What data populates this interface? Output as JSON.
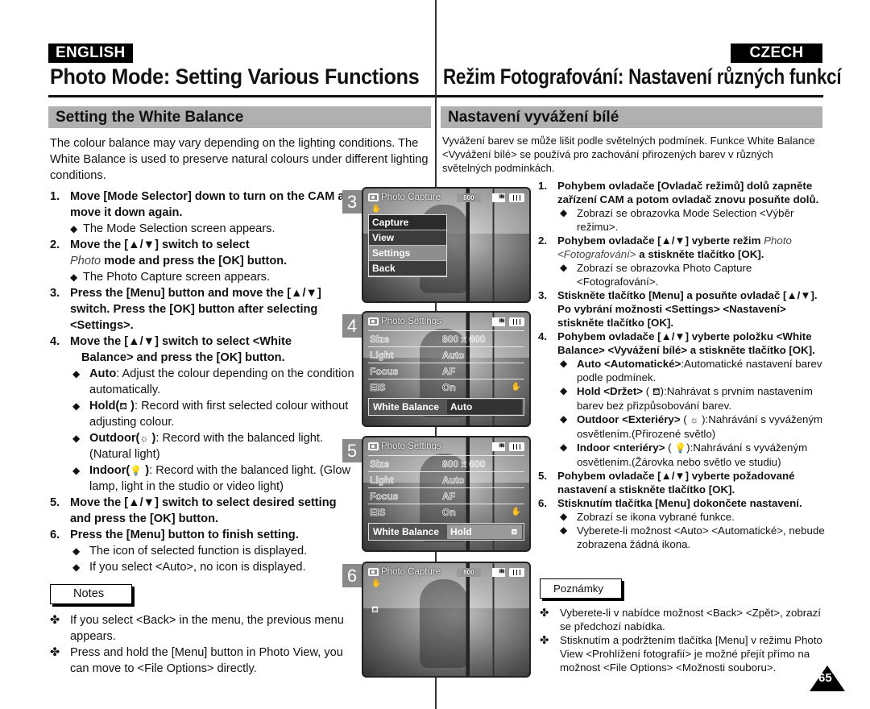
{
  "header": {
    "lang_en": "ENGLISH",
    "lang_cz": "CZECH",
    "title_en": "Photo Mode: Setting Various Functions",
    "title_cz": "Režim Fotografování: Nastavení různých funkcí"
  },
  "english": {
    "section_title": "Setting the White Balance",
    "intro": "The colour balance may vary depending on the lighting conditions. The White Balance is used to preserve natural colours under different lighting conditions.",
    "steps": [
      {
        "num": "1.",
        "text": "Move [Mode Selector] down to turn on the CAM and move it down again.",
        "sub": "The Mode Selection screen appears."
      },
      {
        "num": "2.",
        "text_italic": "Photo",
        "text_pre": "Move the [▲/▼] switch to select",
        "text_post": "mode and press the [OK] button.",
        "sub": "The Photo Capture screen appears."
      },
      {
        "num": "3.",
        "text": "Press the [Menu] button and move the [▲/▼] switch. Press the [OK] button after selecting <Settings>."
      },
      {
        "num": "4.",
        "text_a": "Move the [▲/▼] switch to select <White",
        "text_b": "Balance> and press the [OK] button."
      },
      {
        "num": "5.",
        "text": "Move the [▲/▼] switch to select desired setting and press the [OK] button."
      },
      {
        "num": "6.",
        "text": "Press the [Menu] button to finish setting."
      }
    ],
    "wb_options": [
      {
        "label": "Auto",
        "icon": "",
        "desc": ": Adjust the colour depending on the condition automatically."
      },
      {
        "label": "Hold(",
        "icon": "hold-icon",
        "icon_glyph": "⛾",
        "label_end": " )",
        "desc": ": Record with first selected colour without adjusting colour."
      },
      {
        "label": "Outdoor(",
        "icon": "outdoor-sun-icon",
        "icon_glyph": "☼",
        "label_end": " )",
        "desc": ": Record with the balanced light. (Natural light)"
      },
      {
        "label": "Indoor(",
        "icon": "indoor-bulb-icon",
        "icon_glyph": "💡",
        "label_end": " )",
        "desc": ": Record with the balanced light. (Glow lamp, light in the studio or video light)"
      }
    ],
    "step6_subs": [
      "The icon of selected function is displayed.",
      "If you select <Auto>, no icon is displayed."
    ],
    "notes_label": "Notes",
    "notes": [
      "If you select <Back> in the menu, the previous menu appears.",
      "Press and hold the [Menu] button in Photo View, you can move to <File Options> directly."
    ]
  },
  "czech": {
    "section_title": "Nastavení vyvážení bílé",
    "intro": "Vyvážení barev se může lišit podle světelných podmínek. Funkce White Balance <Vyvážení bílé> se používá pro zachování přirozených barev v různých světelných podmínkách.",
    "steps": [
      {
        "num": "1.",
        "text": "Pohybem ovladače [Ovladač režimů] dolů zapněte zařízení CAM a potom ovladač znovu posuňte dolů.",
        "sub": "Zobrazí se obrazovka Mode Selection <Výběr režimu>."
      },
      {
        "num": "2.",
        "text_pre": "Pohybem ovladače [▲/▼] vyberte režim",
        "text_italic": "Photo <Fotografování>",
        "text_post": "a stiskněte tlačítko [OK].",
        "sub": "Zobrazí se obrazovka Photo Capture <Fotografování>."
      },
      {
        "num": "3.",
        "text": "Stiskněte tlačítko [Menu] a posuňte ovladač [▲/▼]. Po vybrání možnosti <Settings> <Nastavení> stiskněte tlačítko [OK]."
      },
      {
        "num": "4.",
        "text": "Pohybem ovladače [▲/▼] vyberte položku <White Balance> <Vyvážení bílé> a stiskněte tlačítko [OK]."
      },
      {
        "num": "5.",
        "text": "Pohybem ovladače [▲/▼] vyberte požadované nastavení a stiskněte tlačítko [OK]."
      },
      {
        "num": "6.",
        "text": "Stisknutím tlačítka [Menu] dokončete nastavení."
      }
    ],
    "wb_options": [
      {
        "label": "Auto <Automatické>",
        "desc": ":Automatické nastavení barev podle podmínek."
      },
      {
        "label": "Hold <Držet>",
        "pre_icon": " ( ",
        "icon_glyph": "⛾",
        "desc": "):Nahrávat s prvním nastavením barev bez přizpůsobování barev."
      },
      {
        "label": "Outdoor <Exteriéry>",
        "pre_icon": " ( ",
        "icon_glyph": "☼",
        "desc": " ):Nahrávání s vyváženým osvětlením.(Přirozené světlo)"
      },
      {
        "label": "Indoor <nteriéry>",
        "pre_icon": " ( ",
        "icon_glyph": "💡",
        "desc": "):Nahrávání s vyváženým osvětlením.(Žárovka nebo světlo ve studiu)"
      }
    ],
    "step6_subs": [
      "Zobrazí se ikona vybrané funkce.",
      "Vyberete-li možnost <Auto> <Automatické>, nebude zobrazena žádná ikona."
    ],
    "notes_label": "Poznámky",
    "notes": [
      "Vyberete-li v nabídce možnost <Back> <Zpět>, zobrazí se předchozí nabídka.",
      "Stisknutím a podržtením tlačítka [Menu] v režimu Photo View <Prohlížení fotografií> je možné přejít přímo na možnost <File Options> <Možnosti souboru>."
    ]
  },
  "screens": [
    {
      "step": "3",
      "title": "Photo Capture",
      "resolution": "800",
      "memory": "IN",
      "menu": [
        "Capture",
        "View",
        "Settings",
        "Back"
      ],
      "highlighted": "Settings"
    },
    {
      "step": "4",
      "title": "Photo Settings",
      "memory": "IN",
      "rows": [
        {
          "label": "Size",
          "value": "800 x 600"
        },
        {
          "label": "Light",
          "value": "Auto"
        },
        {
          "label": "Focus",
          "value": "AF"
        },
        {
          "label": "EIS",
          "value": "On"
        }
      ],
      "wb_label": "White Balance",
      "wb_value": "Auto"
    },
    {
      "step": "5",
      "title": "Photo Settings",
      "memory": "IN",
      "rows": [
        {
          "label": "Size",
          "value": "800 x 600"
        },
        {
          "label": "Light",
          "value": "Auto"
        },
        {
          "label": "Focus",
          "value": "AF"
        },
        {
          "label": "EIS",
          "value": "On"
        }
      ],
      "wb_label": "White Balance",
      "wb_value": "Hold"
    },
    {
      "step": "6",
      "title": "Photo Capture",
      "resolution": "800",
      "memory": "IN"
    }
  ],
  "glyphs": {
    "bullet": "◆",
    "note_mark": "✤",
    "hand": "✋",
    "hold": "⛾"
  },
  "page_number": "65"
}
